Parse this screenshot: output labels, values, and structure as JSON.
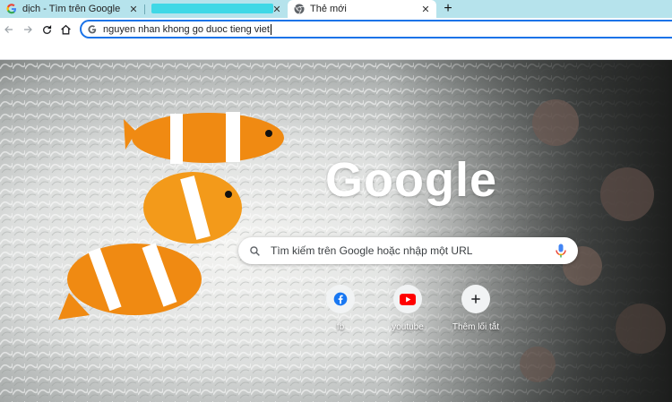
{
  "tabs": [
    {
      "title": "dịch - Tìm trên Google",
      "favicon": "google-g-icon"
    },
    {
      "title": "",
      "favicon": ""
    },
    {
      "title": "Thẻ mới",
      "favicon": "chrome-icon"
    }
  ],
  "toolbar": {
    "address_value": "nguyen nhan khong go duoc tieng viet"
  },
  "ntp": {
    "logo_text": "Google",
    "search_placeholder": "Tìm kiếm trên Google hoặc nhập một URL",
    "shortcuts": [
      {
        "label": "fb",
        "icon": "facebook-icon"
      },
      {
        "label": "youtube",
        "icon": "youtube-icon"
      },
      {
        "label": "Thêm lối tắt",
        "icon": "plus-icon"
      }
    ]
  },
  "colors": {
    "tabstrip": "#b6e3ec",
    "accent": "#1a73e8",
    "facebook": "#1877f2",
    "youtube": "#ff0000"
  }
}
